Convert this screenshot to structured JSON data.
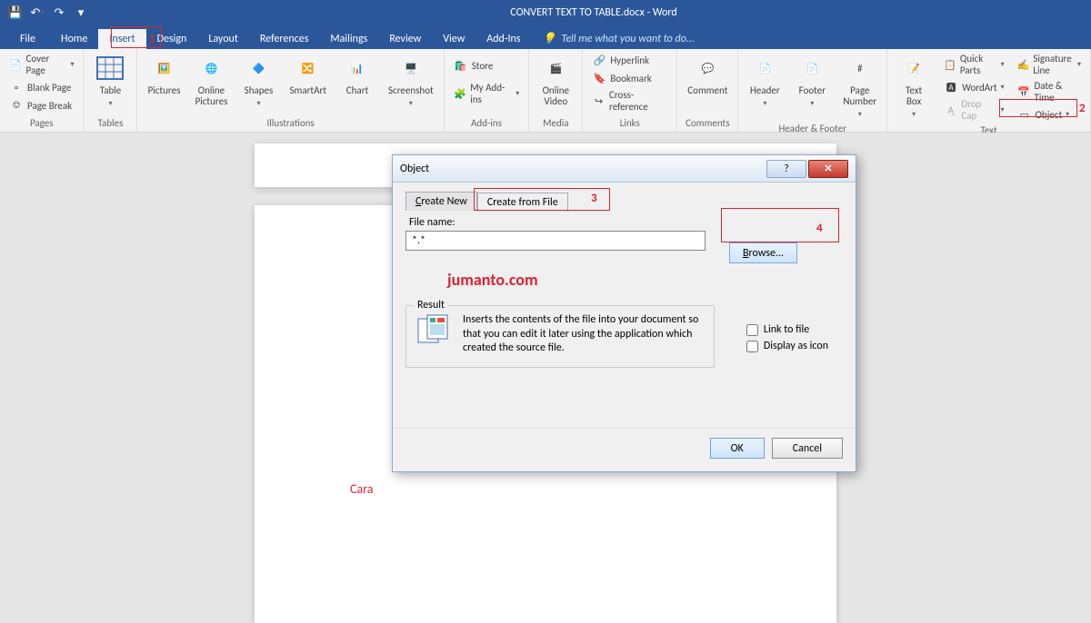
{
  "title": "CONVERT TEXT TO TABLE.docx - Word",
  "qat": {
    "save": "💾",
    "undo": "↶",
    "redo": "↷"
  },
  "tabs": {
    "file": "File",
    "home": "Home",
    "insert": "Insert",
    "design": "Design",
    "layout": "Layout",
    "references": "References",
    "mailings": "Mailings",
    "review": "Review",
    "view": "View",
    "addins": "Add-Ins"
  },
  "tellme": "Tell me what you want to do...",
  "ribbon": {
    "pages": {
      "label": "Pages",
      "cover": "Cover Page",
      "blank": "Blank Page",
      "break": "Page Break"
    },
    "tables": {
      "label": "Tables",
      "table": "Table"
    },
    "illus": {
      "label": "Illustrations",
      "pictures": "Pictures",
      "online": "Online\nPictures",
      "shapes": "Shapes",
      "smartart": "SmartArt",
      "chart": "Chart",
      "screenshot": "Screenshot"
    },
    "addins": {
      "label": "Add-ins",
      "store": "Store",
      "my": "My Add-ins"
    },
    "media": {
      "label": "Media",
      "video": "Online\nVideo"
    },
    "links": {
      "label": "Links",
      "hyperlink": "Hyperlink",
      "bookmark": "Bookmark",
      "xref": "Cross-reference"
    },
    "comments": {
      "label": "Comments",
      "comment": "Comment"
    },
    "hf": {
      "label": "Header & Footer",
      "header": "Header",
      "footer": "Footer",
      "pagenum": "Page\nNumber"
    },
    "text": {
      "label": "Text",
      "textbox": "Text\nBox",
      "qparts": "Quick Parts",
      "wordart": "WordArt",
      "dropcap": "Drop Cap",
      "sig": "Signature Line",
      "datetime": "Date & Time",
      "object": "Object"
    }
  },
  "dialog": {
    "title": "Object",
    "tab_new": "Create New",
    "tab_file": "Create from File",
    "file_label": "File name:",
    "file_value": "*.*",
    "browse": "Browse...",
    "link": "Link to file",
    "dispicon": "Display as icon",
    "result_label": "Result",
    "result_text": "Inserts the contents of the file into your document so that you can edit it later using the application which created the source file.",
    "ok": "OK",
    "cancel": "Cancel"
  },
  "watermark": "jumanto.com",
  "cara": "Cara",
  "callouts": {
    "n1": "1",
    "n2": "2",
    "n3": "3",
    "n4": "4"
  }
}
